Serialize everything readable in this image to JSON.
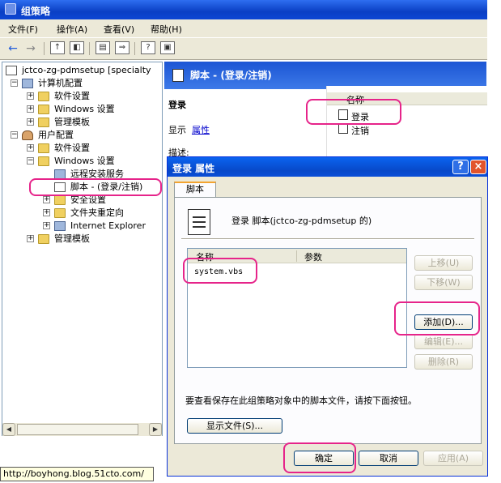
{
  "window": {
    "title": "组策略"
  },
  "menu": [
    "文件(F)",
    "操作(A)",
    "查看(V)",
    "帮助(H)"
  ],
  "tree": {
    "root": "jctco-zg-pdmsetup [specialty",
    "computer_config": "计算机配置",
    "software_settings": "软件设置",
    "windows_settings": "Windows 设置",
    "admin_templates": "管理模板",
    "user_config": "用户配置",
    "user_software_settings": "软件设置",
    "user_windows_settings": "Windows 设置",
    "remote_install": "远程安装服务",
    "scripts": "脚本 - (登录/注销)",
    "security_settings": "安全设置",
    "folder_redirection": "文件夹重定向",
    "internet_explorer": "Internet Explorer",
    "user_admin_templates": "管理模板"
  },
  "status_url": "http://boyhong.blog.51cto.com/",
  "right_pane": {
    "header": "脚本 - (登录/注销)",
    "section_title": "登录",
    "display_label": "显示",
    "properties_link": "属性",
    "description_label": "描述:",
    "list_column_name": "名称",
    "items": [
      "登录",
      "注销"
    ]
  },
  "dialog": {
    "title": "登录 属性",
    "help": "?",
    "close": "×",
    "tab": "脚本",
    "heading": "登录 脚本(jctco-zg-pdmsetup 的)",
    "columns": [
      "名称",
      "参数"
    ],
    "scripts": [
      "system.vbs"
    ],
    "buttons": {
      "move_up": "上移(U)",
      "move_down": "下移(W)",
      "add": "添加(D)...",
      "edit": "编辑(E)...",
      "remove": "删除(R)"
    },
    "info_text": "要查看保存在此组策略对象中的脚本文件，请按下面按钮。",
    "show_files": "显示文件(S)...",
    "ok": "确定",
    "cancel": "取消",
    "apply": "应用(A)"
  },
  "colors": {
    "highlight": "#e6248a",
    "xp_blue": "#0a4ed8"
  }
}
